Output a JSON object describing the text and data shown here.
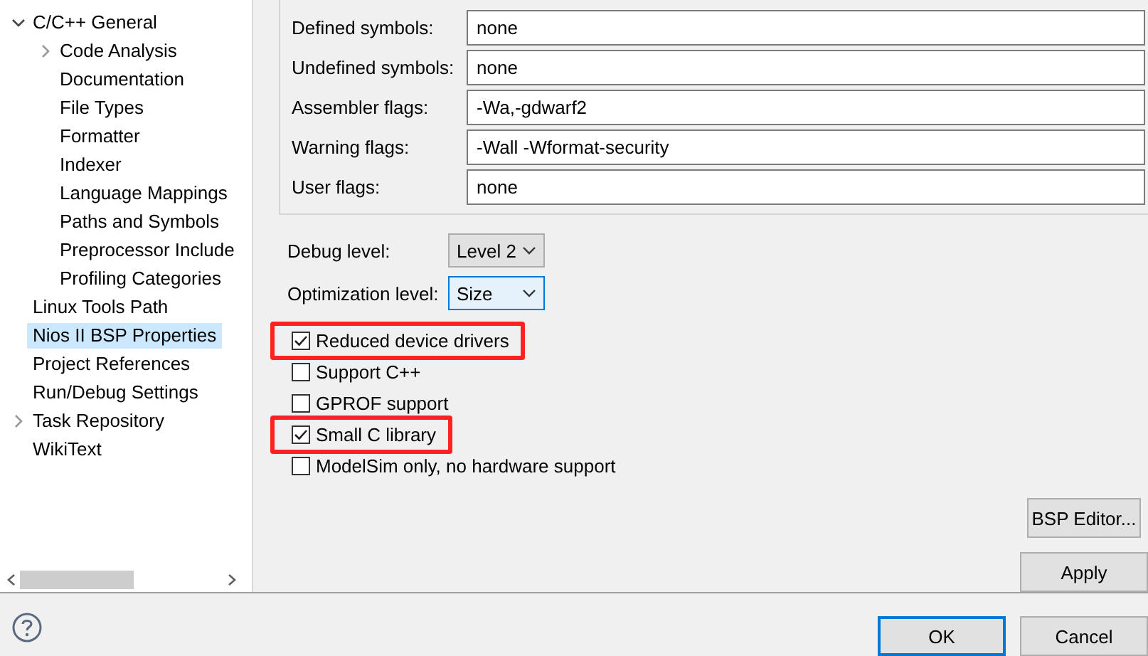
{
  "sidebar": {
    "items": [
      {
        "label": "C/C++ General",
        "expanded": true,
        "selected": false,
        "children": [
          {
            "label": "Code Analysis",
            "expanded": false,
            "selected": false
          },
          {
            "label": "Documentation",
            "selected": false
          },
          {
            "label": "File Types",
            "selected": false
          },
          {
            "label": "Formatter",
            "selected": false
          },
          {
            "label": "Indexer",
            "selected": false
          },
          {
            "label": "Language Mappings",
            "selected": false
          },
          {
            "label": "Paths and Symbols",
            "selected": false
          },
          {
            "label": "Preprocessor Include",
            "selected": false
          },
          {
            "label": "Profiling Categories",
            "selected": false
          }
        ]
      },
      {
        "label": "Linux Tools Path",
        "selected": false
      },
      {
        "label": "Nios II BSP Properties",
        "selected": true
      },
      {
        "label": "Project References",
        "selected": false
      },
      {
        "label": "Run/Debug Settings",
        "selected": false
      },
      {
        "label": "Task Repository",
        "expanded": false,
        "selected": false
      },
      {
        "label": "WikiText",
        "selected": false
      }
    ]
  },
  "flags": [
    {
      "label": "Defined symbols:",
      "value": "none"
    },
    {
      "label": "Undefined symbols:",
      "value": "none"
    },
    {
      "label": "Assembler flags:",
      "value": "-Wa,-gdwarf2"
    },
    {
      "label": "Warning flags:",
      "value": "-Wall -Wformat-security"
    },
    {
      "label": "User flags:",
      "value": "none"
    }
  ],
  "selects": [
    {
      "label": "Debug level:",
      "value": "Level 2",
      "focused": false
    },
    {
      "label": "Optimization level:",
      "value": "Size",
      "focused": true
    }
  ],
  "options": [
    {
      "label": "Reduced device drivers",
      "checked": true,
      "highlighted": true
    },
    {
      "label": "Support C++",
      "checked": false,
      "highlighted": false
    },
    {
      "label": "GPROF support",
      "checked": false,
      "highlighted": false
    },
    {
      "label": "Small C library",
      "checked": true,
      "highlighted": true
    },
    {
      "label": "ModelSim only, no hardware support",
      "checked": false,
      "highlighted": false
    }
  ],
  "bsp_button": "BSP Editor...",
  "apply_button": "Apply",
  "dialog_buttons": [
    {
      "label": "OK",
      "default": true
    },
    {
      "label": "Cancel",
      "default": false
    }
  ]
}
